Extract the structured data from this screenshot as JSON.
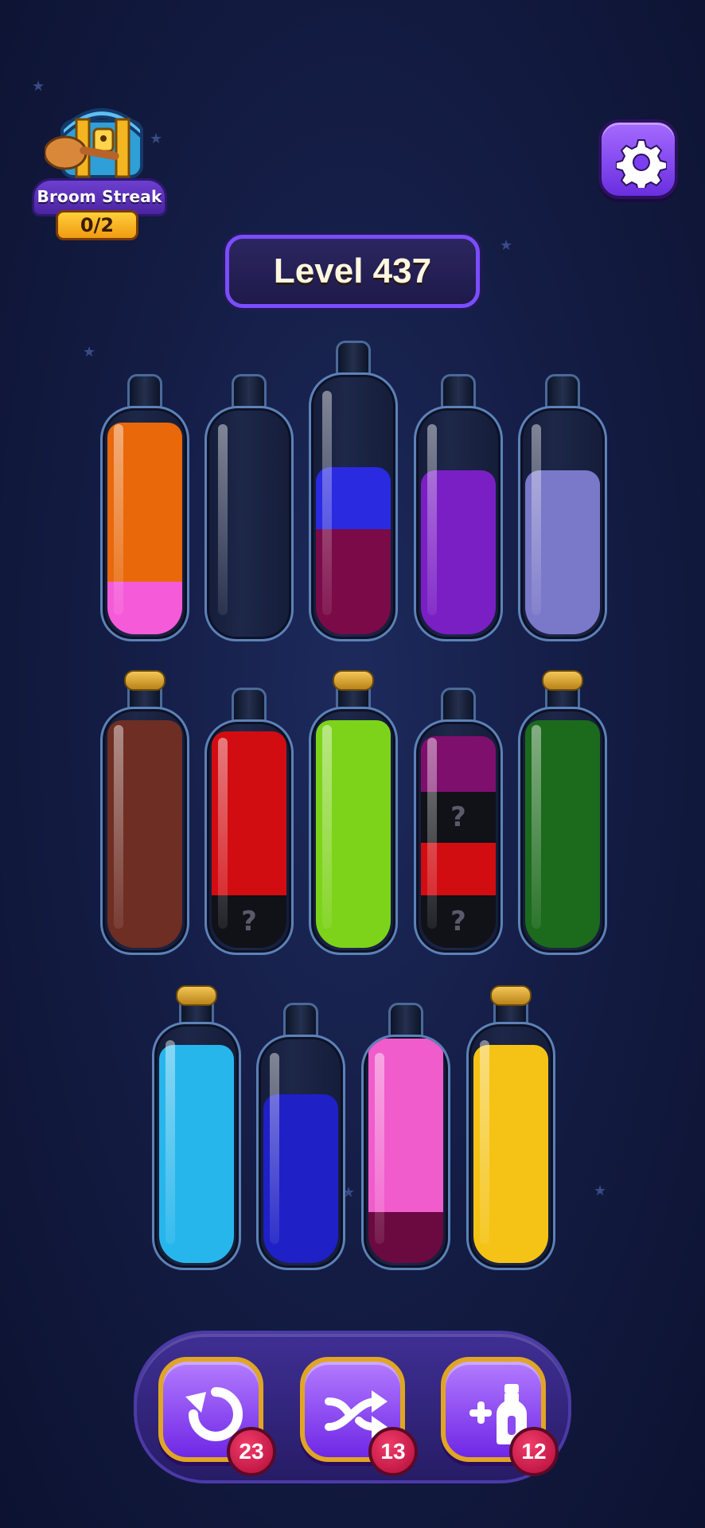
{
  "header": {
    "streak_label": "Broom Streak",
    "streak_count": "0/2",
    "level_label": "Level 437"
  },
  "bottles": [
    {
      "row": 1,
      "capped": false,
      "layers": [
        {
          "color": "#e8680a",
          "unknown": false
        },
        {
          "color": "#f55ad8",
          "unknown": false
        }
      ]
    },
    {
      "row": 1,
      "capped": false,
      "layers": []
    },
    {
      "row": 1,
      "capped": false,
      "layers": [
        {
          "color": "#2a2ae0",
          "unknown": false
        },
        {
          "color": "#7a0a48",
          "unknown": false
        }
      ]
    },
    {
      "row": 1,
      "capped": false,
      "layers": [
        {
          "color": "#7a1fc4",
          "unknown": false
        }
      ]
    },
    {
      "row": 1,
      "capped": false,
      "layers": [
        {
          "color": "#7a78c8",
          "unknown": false
        }
      ]
    },
    {
      "row": 2,
      "capped": true,
      "layers": [
        {
          "color": "#6e2e24",
          "unknown": false
        }
      ]
    },
    {
      "row": 2,
      "capped": false,
      "layers": [
        {
          "color": "#d20d12",
          "unknown": false
        },
        {
          "color": "#111118",
          "unknown": true
        }
      ]
    },
    {
      "row": 2,
      "capped": true,
      "layers": [
        {
          "color": "#7dd31a",
          "unknown": false
        }
      ]
    },
    {
      "row": 2,
      "capped": false,
      "layers": [
        {
          "color": "#7e0f6c",
          "unknown": false
        },
        {
          "color": "#111118",
          "unknown": true
        },
        {
          "color": "#d20d12",
          "unknown": false
        },
        {
          "color": "#111118",
          "unknown": true
        }
      ]
    },
    {
      "row": 2,
      "capped": true,
      "layers": [
        {
          "color": "#1c6a1c",
          "unknown": false
        }
      ]
    },
    {
      "row": 3,
      "capped": true,
      "layers": [
        {
          "color": "#27b6ec",
          "unknown": false
        }
      ]
    },
    {
      "row": 3,
      "capped": false,
      "layers": [
        {
          "color": "#1f20c6",
          "unknown": false
        }
      ]
    },
    {
      "row": 3,
      "capped": false,
      "layers": [
        {
          "color": "#f05ccb",
          "unknown": false
        },
        {
          "color": "#6b0a40",
          "unknown": false
        }
      ]
    },
    {
      "row": 3,
      "capped": true,
      "layers": [
        {
          "color": "#f5c316",
          "unknown": false
        }
      ]
    }
  ],
  "unknown_mark": "?",
  "tools": {
    "undo": {
      "icon": "undo-icon",
      "count": "23"
    },
    "shuffle": {
      "icon": "shuffle-icon",
      "count": "13"
    },
    "add_bottle": {
      "icon": "add-bottle-icon",
      "count": "12"
    }
  },
  "colors": {
    "background": "#141d45",
    "accent": "#7b4dff",
    "badge": "#d11446"
  }
}
